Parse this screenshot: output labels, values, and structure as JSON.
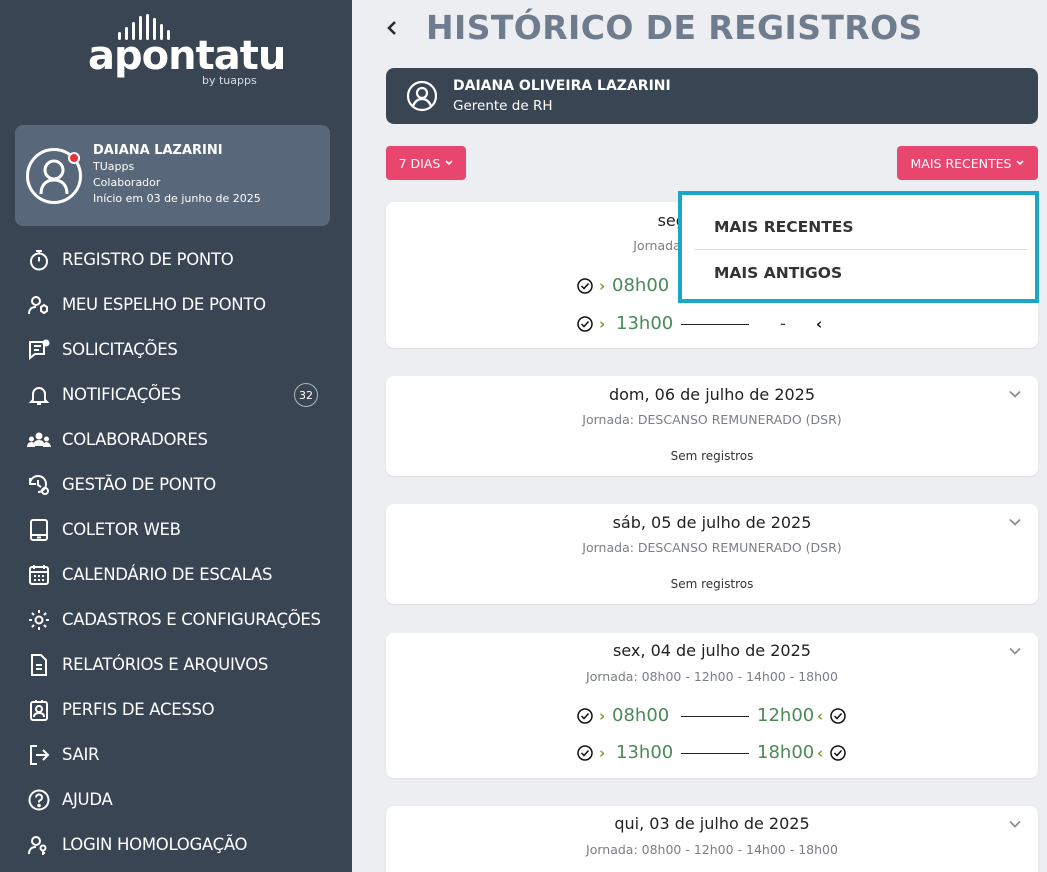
{
  "brand": {
    "name": "apontatu",
    "by": "by tuapps"
  },
  "user": {
    "name": "DAIANA LAZARINI",
    "company": "TUapps",
    "role": "Colaborador",
    "since": "Início em 03 de junho de 2025"
  },
  "menu": [
    {
      "label": "REGISTRO DE PONTO",
      "icon": "stopwatch-icon"
    },
    {
      "label": "MEU ESPELHO DE PONTO",
      "icon": "user-settings-icon"
    },
    {
      "label": "SOLICITAÇÕES",
      "icon": "chat-request-icon"
    },
    {
      "label": "NOTIFICAÇÕES",
      "icon": "bell-icon",
      "badge": "32"
    },
    {
      "label": "COLABORADORES",
      "icon": "team-icon"
    },
    {
      "label": "GESTÃO DE PONTO",
      "icon": "time-management-icon"
    },
    {
      "label": "COLETOR WEB",
      "icon": "tablet-icon"
    },
    {
      "label": "CALENDÁRIO DE ESCALAS",
      "icon": "calendar-icon"
    },
    {
      "label": "CADASTROS E CONFIGURAÇÕES",
      "icon": "gear-icon"
    },
    {
      "label": "RELATÓRIOS E ARQUIVOS",
      "icon": "document-icon"
    },
    {
      "label": "PERFIS DE ACESSO",
      "icon": "profile-badge-icon"
    },
    {
      "label": "SAIR",
      "icon": "logout-icon"
    },
    {
      "label": "AJUDA",
      "icon": "help-icon"
    },
    {
      "label": "LOGIN HOMOLOGAÇÃO",
      "icon": "user-key-icon"
    }
  ],
  "page": {
    "title": "HISTÓRICO DE REGISTROS"
  },
  "employee": {
    "name": "DAIANA OLIVEIRA LAZARINI",
    "role": "Gerente de RH"
  },
  "filters": {
    "period": "7 DIAS",
    "order": "MAIS RECENTES"
  },
  "dropdown": {
    "options": [
      "MAIS RECENTES",
      "MAIS ANTIGOS"
    ]
  },
  "days": [
    {
      "date": "seg, 07",
      "jornada": "Jornada: 08h0",
      "rows": [
        {
          "in": "08h00",
          "out": ""
        },
        {
          "in": "13h00",
          "out": "-"
        }
      ]
    },
    {
      "date": "dom, 06 de julho de 2025",
      "jornada": "Jornada: DESCANSO REMUNERADO (DSR)",
      "empty": "Sem registros"
    },
    {
      "date": "sáb, 05 de julho de 2025",
      "jornada": "Jornada: DESCANSO REMUNERADO (DSR)",
      "empty": "Sem registros"
    },
    {
      "date": "sex, 04 de julho de 2025",
      "jornada": "Jornada: 08h00 - 12h00 - 14h00 - 18h00",
      "rows": [
        {
          "in": "08h00",
          "out": "12h00"
        },
        {
          "in": "13h00",
          "out": "18h00"
        }
      ]
    },
    {
      "date": "qui, 03 de julho de 2025",
      "jornada": "Jornada: 08h00 - 12h00 - 14h00 - 18h00"
    }
  ]
}
